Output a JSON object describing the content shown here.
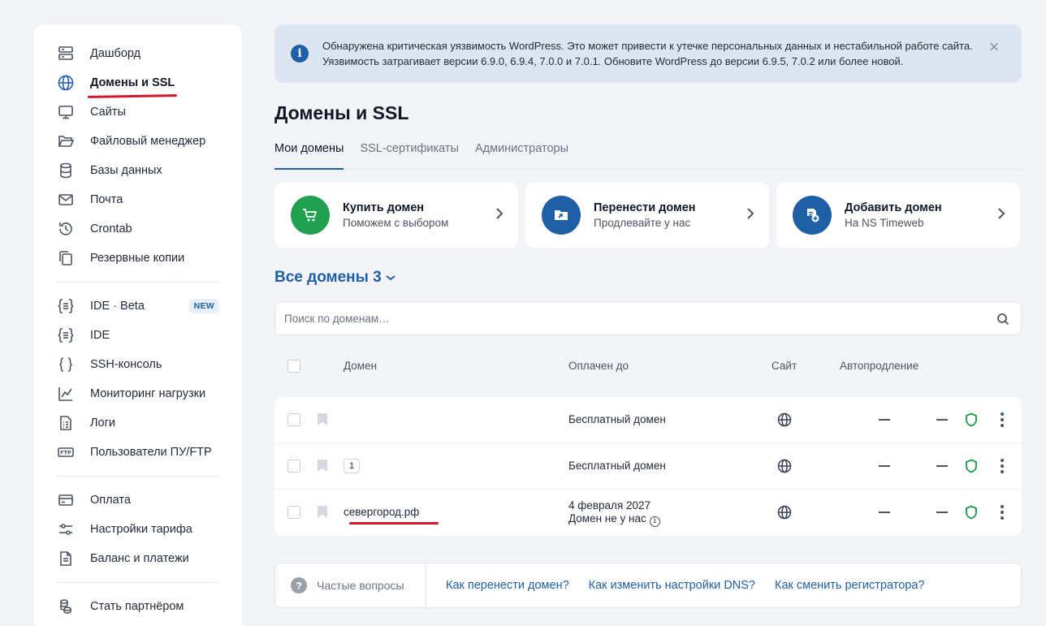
{
  "sidebar": {
    "items": [
      {
        "label": "Дашборд",
        "icon": "dashboard-icon"
      },
      {
        "label": "Домены и SSL",
        "icon": "globe-icon",
        "active": true
      },
      {
        "label": "Сайты",
        "icon": "monitor-icon"
      },
      {
        "label": "Файловый менеджер",
        "icon": "folder-icon"
      },
      {
        "label": "Базы данных",
        "icon": "database-icon"
      },
      {
        "label": "Почта",
        "icon": "mail-icon"
      },
      {
        "label": "Crontab",
        "icon": "history-icon"
      },
      {
        "label": "Резервные копии",
        "icon": "copy-icon"
      },
      {
        "label": "IDE · Beta",
        "icon": "ide-icon",
        "badge": "NEW"
      },
      {
        "label": "IDE",
        "icon": "ide-icon"
      },
      {
        "label": "SSH-консоль",
        "icon": "braces-icon"
      },
      {
        "label": "Мониторинг нагрузки",
        "icon": "chart-icon"
      },
      {
        "label": "Логи",
        "icon": "log-icon"
      },
      {
        "label": "Пользователи ПУ/FTP",
        "icon": "ftp-icon"
      },
      {
        "label": "Оплата",
        "icon": "card-icon"
      },
      {
        "label": "Настройки тарифа",
        "icon": "sliders-icon"
      },
      {
        "label": "Баланс и платежи",
        "icon": "document-icon"
      },
      {
        "label": "Стать партнёром",
        "icon": "coins-icon"
      }
    ]
  },
  "alert": {
    "text": "Обнаружена критическая уязвимость WordPress. Это может привести к утечке персональных данных и нестабильной работе сайта. Уязвимость затрагивает версии 6.9.0, 6.9.4, 7.0.0 и 7.0.1. Обновите WordPress до версии 6.9.5, 7.0.2 или более новой.",
    "close": "×"
  },
  "page": {
    "title": "Домены и SSL"
  },
  "tabs": [
    {
      "label": "Мои домены",
      "active": true
    },
    {
      "label": "SSL-сертификаты"
    },
    {
      "label": "Администраторы"
    }
  ],
  "cards": [
    {
      "title": "Купить домен",
      "subtitle": "Поможем с выбором",
      "color": "#21a04f"
    },
    {
      "title": "Перенести домен",
      "subtitle": "Продлевайте у нас",
      "color": "#1e5fa6"
    },
    {
      "title": "Добавить домен",
      "subtitle": "На NS Timeweb",
      "color": "#1e5fa6"
    }
  ],
  "domains": {
    "header": "Все домены 3",
    "search_placeholder": "Поиск по доменам…",
    "columns": {
      "domain": "Домен",
      "paid_until": "Оплачен до",
      "site": "Сайт",
      "autorenew": "Автопродление"
    },
    "rows": [
      {
        "domain": "",
        "badge": "",
        "paid_until": "Бесплатный домен",
        "note": ""
      },
      {
        "domain": "",
        "badge": "1",
        "paid_until": "Бесплатный домен",
        "note": ""
      },
      {
        "domain": "севергород.рф",
        "badge": "",
        "paid_until": "4 февраля 2027",
        "note": "Домен не у нас"
      }
    ]
  },
  "faq": {
    "label": "Частые вопросы",
    "links": [
      "Как перенести домен?",
      "Как изменить настройки DNS?",
      "Как сменить регистратора?"
    ]
  },
  "colors": {
    "accent": "#1e5fa6",
    "green": "#21a04f",
    "highlight": "#d3162e"
  }
}
